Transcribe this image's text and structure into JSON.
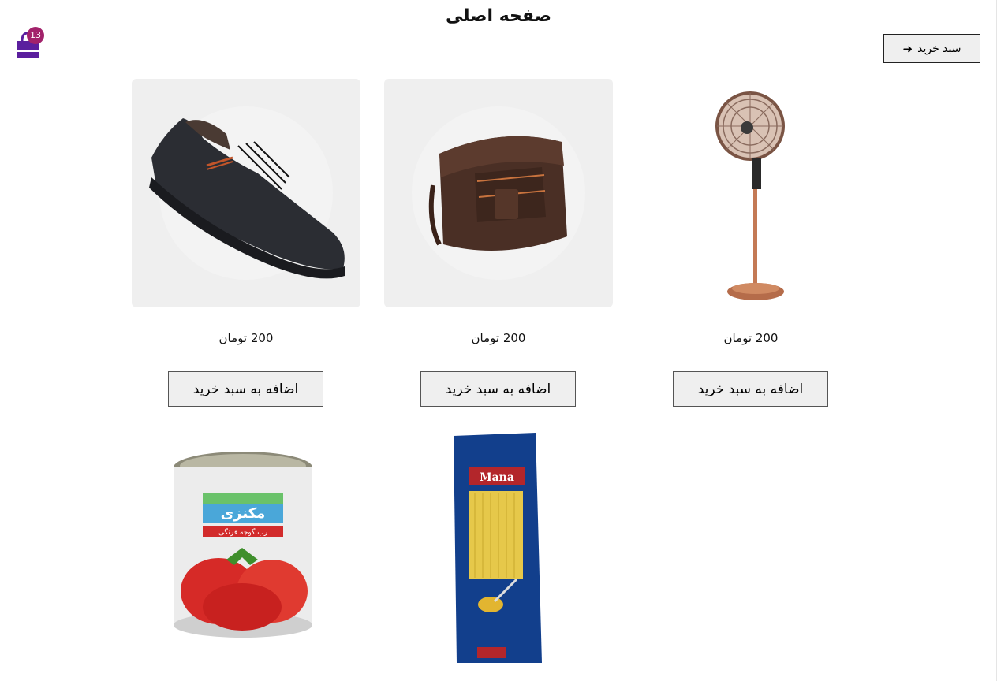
{
  "header": {
    "title": "صفحه اصلی",
    "cart_badge": "13",
    "cart_button_label": "سبد خرید"
  },
  "products": [
    {
      "name": "fan",
      "icon": "standing-fan",
      "price": "200 تومان",
      "add_label": "اضافه به سبد خرید"
    },
    {
      "name": "bag",
      "icon": "leather-bag",
      "price": "200 تومان",
      "add_label": "اضافه به سبد خرید"
    },
    {
      "name": "shoe",
      "icon": "sneaker",
      "price": "200 تومان",
      "add_label": "اضافه به سبد خرید"
    },
    {
      "name": "pasta",
      "icon": "spaghetti-package",
      "label_text": "Mana"
    },
    {
      "name": "tomato-paste",
      "icon": "tomato-paste-can",
      "label_text": "مکنزی",
      "sub_label": "رب گوجه فرنگی"
    }
  ],
  "colors": {
    "badge": "#a2226b",
    "cart_icon": "#5b1f9e",
    "card_bg": "#efefef"
  }
}
